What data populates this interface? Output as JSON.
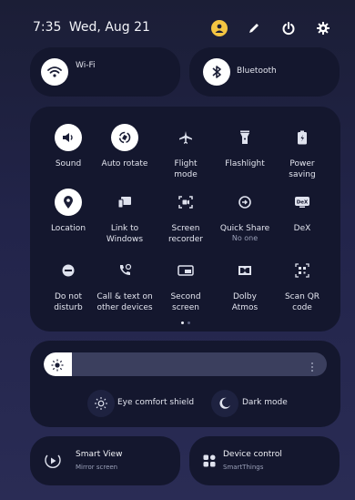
{
  "status": {
    "time": "7:35",
    "date": "Wed, Aug 21"
  },
  "top_icons": [
    "avatar-icon",
    "pencil-icon",
    "power-icon",
    "gear-icon"
  ],
  "connectivity": {
    "wifi": "Wi-Fi",
    "bluetooth": "Bluetooth"
  },
  "tiles": [
    {
      "label": "Sound",
      "icon": "volume-icon",
      "on": true
    },
    {
      "label": "Auto rotate",
      "icon": "rotate-icon",
      "on": true
    },
    {
      "label": "Flight mode",
      "icon": "airplane-icon",
      "on": false
    },
    {
      "label": "Flashlight",
      "icon": "flashlight-icon",
      "on": false
    },
    {
      "label": "Power saving",
      "icon": "battery-icon",
      "on": false
    },
    {
      "label": "Location",
      "icon": "location-icon",
      "on": true
    },
    {
      "label": "Link to Windows",
      "icon": "link-windows-icon",
      "on": false
    },
    {
      "label": "Screen recorder",
      "icon": "screen-recorder-icon",
      "on": false
    },
    {
      "label": "Quick Share",
      "sub": "No one",
      "icon": "quick-share-icon",
      "on": false
    },
    {
      "label": "DeX",
      "icon": "dex-icon",
      "on": false
    },
    {
      "label": "Do not disturb",
      "icon": "dnd-icon",
      "on": false
    },
    {
      "label": "Call & text on other devices",
      "icon": "call-text-icon",
      "on": false
    },
    {
      "label": "Second screen",
      "icon": "second-screen-icon",
      "on": false
    },
    {
      "label": "Dolby Atmos",
      "icon": "dolby-icon",
      "on": false
    },
    {
      "label": "Scan QR code",
      "icon": "qr-icon",
      "on": false
    }
  ],
  "brightness": {
    "level": 0.1
  },
  "eye_comfort": "Eye comfort shield",
  "dark_mode": "Dark mode",
  "bottom": {
    "smart_view": {
      "title": "Smart View",
      "sub": "Mirror screen"
    },
    "device_control": {
      "title": "Device control",
      "sub": "SmartThings"
    }
  },
  "colors": {
    "panel": "#14172e",
    "accent": "#f4c542",
    "tile_on": "#ffffff"
  }
}
